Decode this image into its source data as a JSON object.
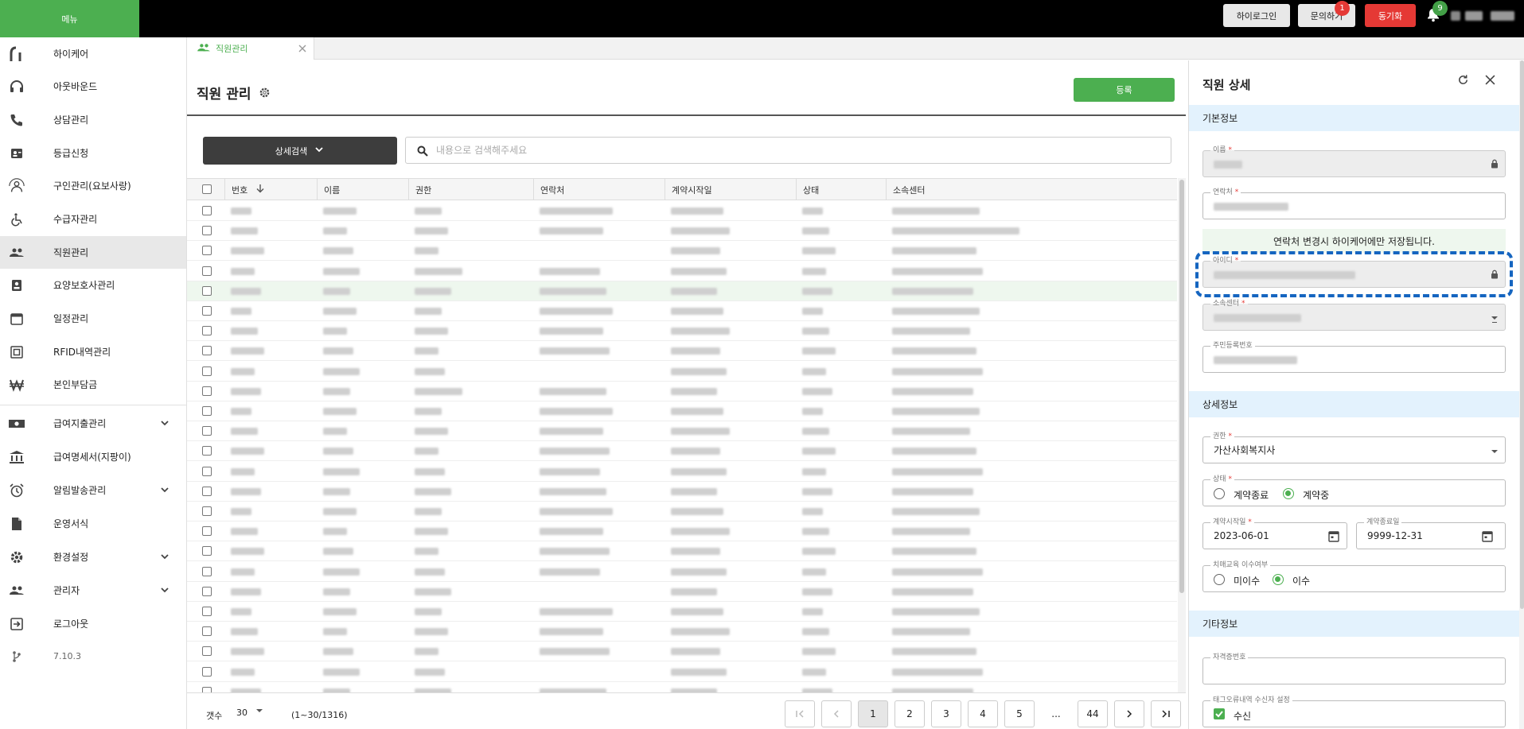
{
  "topbar": {
    "menu_label": "메뉴",
    "login_button": "하이로그인",
    "inquiry_button": "문의하기",
    "inquiry_badge": "1",
    "sync_button": "동기화",
    "notification_badge": "9"
  },
  "sidebar": {
    "items": [
      {
        "label": "하이케어",
        "icon": "brand-icon"
      },
      {
        "label": "아웃바운드",
        "icon": "headset-icon"
      },
      {
        "label": "상담관리",
        "icon": "phone-icon"
      },
      {
        "label": "등급신청",
        "icon": "id-card-icon"
      },
      {
        "label": "구인관리(요보사랑)",
        "icon": "people-search-icon"
      },
      {
        "label": "수급자관리",
        "icon": "wheelchair-icon"
      },
      {
        "label": "직원관리",
        "icon": "group-icon"
      },
      {
        "label": "요양보호사관리",
        "icon": "badge-icon"
      },
      {
        "label": "일정관리",
        "icon": "calendar-icon"
      },
      {
        "label": "RFID내역관리",
        "icon": "rfid-icon"
      },
      {
        "label": "본인부담금",
        "icon": "won-icon"
      },
      {
        "label": "급여지출관리",
        "icon": "money-icon"
      },
      {
        "label": "급여명세서(지팡이)",
        "icon": "bank-icon"
      },
      {
        "label": "알림발송관리",
        "icon": "alarm-icon"
      },
      {
        "label": "운영서식",
        "icon": "document-icon"
      },
      {
        "label": "환경설정",
        "icon": "gear-icon"
      },
      {
        "label": "관리자",
        "icon": "admin-icon"
      },
      {
        "label": "로그아웃",
        "icon": "logout-icon"
      },
      {
        "label": "7.10.3",
        "icon": "version-icon"
      }
    ]
  },
  "tab": {
    "label": "직원관리"
  },
  "main": {
    "title": "직원 관리",
    "register_button": "등록",
    "advanced_search": "상세검색",
    "search_placeholder": "내용으로 검색해주세요",
    "columns": [
      "번호",
      "이름",
      "권한",
      "연락처",
      "계약시작일",
      "상태",
      "소속센터"
    ]
  },
  "footer": {
    "count_label": "갯수",
    "page_size": "30",
    "range": "(1~30/1316)",
    "pages": [
      "1",
      "2",
      "3",
      "4",
      "5",
      "...",
      "44"
    ]
  },
  "panel": {
    "title": "직원 상세",
    "basic_section": "기본정보",
    "name_label": "이름",
    "contact_label": "연락처",
    "contact_notice": "연락처 변경시 하이케어에만 저장됩니다.",
    "id_label": "아이디",
    "center_label": "소속센터",
    "rrn_label": "주민등록번호",
    "detail_section": "상세정보",
    "role_label": "권한",
    "role_value": "가산사회복지사",
    "status_label": "상태",
    "status_options": [
      "계약종료",
      "계약중"
    ],
    "status_selected": "계약중",
    "start_label": "계약시작일",
    "start_value": "2023-06-01",
    "end_label": "계약종료일",
    "end_value": "9999-12-31",
    "edu_label": "치매교육 이수여부",
    "edu_options": [
      "미이수",
      "이수"
    ],
    "edu_selected": "이수",
    "other_section": "기타정보",
    "cert_label": "자격증번호",
    "tag_label": "태그오류내역 수신자 설정",
    "tag_check_label": "수신"
  },
  "colors": {
    "brand_green": "#4caf50",
    "alert_red": "#e53935",
    "focus_blue": "#1565c0",
    "section_blue": "#e3f2fd"
  }
}
